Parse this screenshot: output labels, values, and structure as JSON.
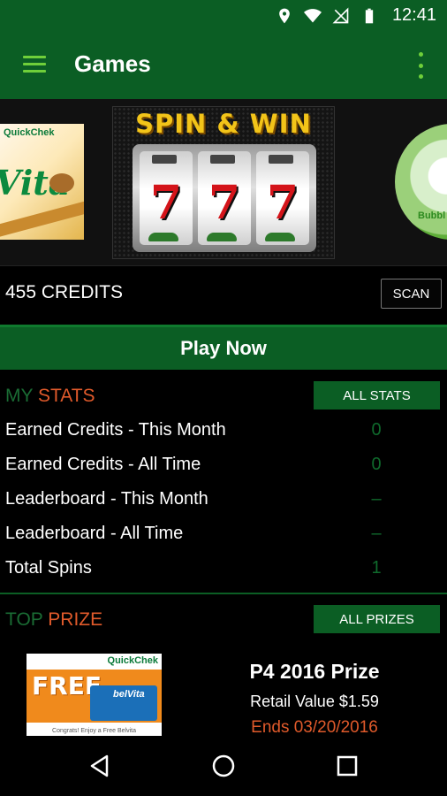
{
  "status_bar": {
    "time": "12:41",
    "icons": [
      "location-icon",
      "wifi-icon",
      "no-signal-icon",
      "battery-icon"
    ]
  },
  "app_bar": {
    "title": "Games",
    "menu_icon": "hamburger-menu-icon",
    "overflow_icon": "more-vert-icon"
  },
  "carousel": {
    "slot_title": "SPIN & WIN",
    "reel_symbol": "7",
    "left_brand": "QuickChek",
    "left_logo": "Vita",
    "right_label": "Bubbl"
  },
  "credits": {
    "text": "455 CREDITS",
    "scan_label": "SCAN"
  },
  "play_now_label": "Play Now",
  "my_stats": {
    "title_a": "MY",
    "title_b": "STATS",
    "button_label": "ALL STATS",
    "rows": [
      {
        "label": "Earned Credits - This Month",
        "value": "0"
      },
      {
        "label": "Earned Credits - All Time",
        "value": "0"
      },
      {
        "label": "Leaderboard - This Month",
        "value": "–"
      },
      {
        "label": "Leaderboard - All Time",
        "value": "–"
      },
      {
        "label": "Total Spins",
        "value": "1"
      }
    ]
  },
  "top_prize": {
    "title_a": "TOP",
    "title_b": "PRIZE",
    "button_label": "ALL PRIZES",
    "image": {
      "brand": "QuickChek",
      "free": "FREE",
      "product": "belVita",
      "caption": "Congrats! Enjoy a Free Belvita"
    },
    "name": "P4 2016 Prize",
    "retail": "Retail Value $1.59",
    "ends": "Ends 03/20/2016"
  },
  "colors": {
    "brand_green": "#0b5e24",
    "accent_orange": "#e05a2b",
    "light_green": "#6fcf3a"
  }
}
